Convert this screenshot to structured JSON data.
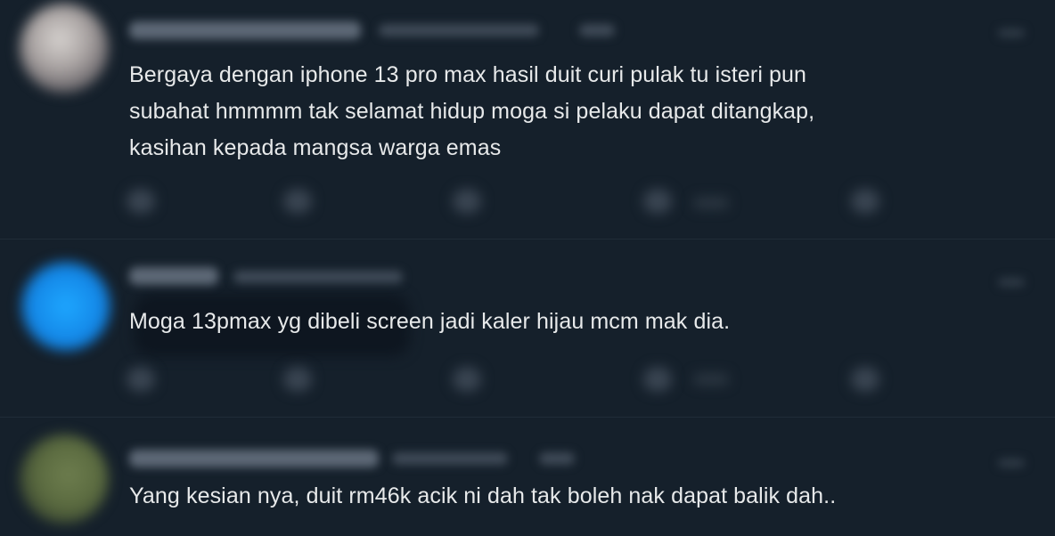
{
  "tweets": [
    {
      "text": "Bergaya dengan iphone 13 pro max hasil duit curi pulak tu isteri pun\nsubahat hmmmm tak selamat hidup moga si pelaku dapat ditangkap,\nkasihan kepada mangsa warga emas"
    },
    {
      "text": "Moga 13pmax yg dibeli screen jadi kaler hijau mcm mak dia."
    },
    {
      "text": "Yang kesian nya, duit rm46k acik ni dah tak boleh nak dapat balik dah.."
    }
  ],
  "colors": {
    "background": "#15202b",
    "text": "#e7e9ea"
  },
  "icons": [
    "reply-icon",
    "retweet-icon",
    "like-icon",
    "views-icon",
    "share-icon",
    "more-icon"
  ]
}
